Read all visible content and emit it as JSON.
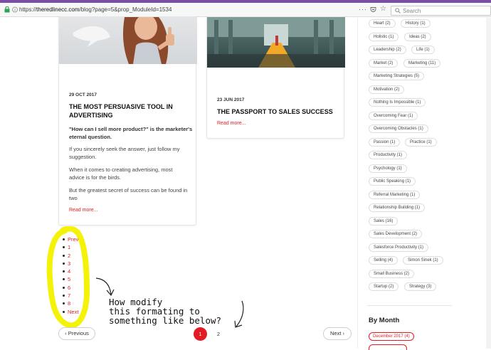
{
  "browser": {
    "url_scheme": "https://",
    "url_host": "theredlinecc.com",
    "url_path": "/blog?page=5&prop_ModuleId=1534",
    "search_placeholder": "Search",
    "more_icon": "···"
  },
  "posts": [
    {
      "date": "29 OCT 2017",
      "title_line1": "THE MOST PERSUASIVE TOOL IN",
      "title_line2": "ADVERTISING",
      "lead_line1": "\"How can I sell more product?\" is the marketer's",
      "lead_line2": "eternal question.",
      "p1_line1": "If you sincerely seek the answer, just follow my",
      "p1_line2": "suggestion.",
      "p2_line1": "When it comes to creating advertising, most",
      "p2_line2": "advice is for the birds.",
      "p3_line1": "But the greatest secret of success can be found in",
      "p3_line2": "two",
      "read_more": "Read more..."
    },
    {
      "date": "23 JUN 2017",
      "title": "THE PASSPORT TO SALES SUCCESS",
      "read_more": "Read more..."
    }
  ],
  "list_pager": [
    "Prev",
    "1",
    "2",
    "3",
    "4",
    "5",
    "6",
    "7",
    "8",
    "Next"
  ],
  "annotation": {
    "line1": "How modify",
    "line2": "this formating to",
    "line3": "something like below?"
  },
  "pagination": {
    "previous": "Previous",
    "next": "Next",
    "page1": "1",
    "page2": "2",
    "chevron_left": "‹",
    "chevron_right": "›"
  },
  "tags": [
    "Heart (2)",
    "History (1)",
    "Holistic (1)",
    "Ideas (2)",
    "Leadership (2)",
    "Life (1)",
    "Market (2)",
    "Marketing (11)",
    "Marketing Strategies (5)",
    "Motivation (2)",
    "Nothing Is Impossible (1)",
    "Overcoming Fear (1)",
    "Overcoming Obstacles (1)",
    "Passion (1)",
    "Practice (1)",
    "Productivity (1)",
    "Psychology (1)",
    "Public Speaking (1)",
    "Referral Marketing (1)",
    "Relationship Building (1)",
    "Sales (16)",
    "Sales Development (2)",
    "Salesforce Productivity (1)",
    "Selling (4)",
    "Simon Sinek (1)",
    "Small Business (2)",
    "Startup (2)",
    "Strategy (3)"
  ],
  "by_month": {
    "heading": "By Month",
    "items": [
      "December 2017 (4)"
    ]
  },
  "colors": {
    "accent_red": "#e31c23",
    "highlight_yellow": "#f5f20a",
    "browser_purple": "#7b4fa8"
  }
}
